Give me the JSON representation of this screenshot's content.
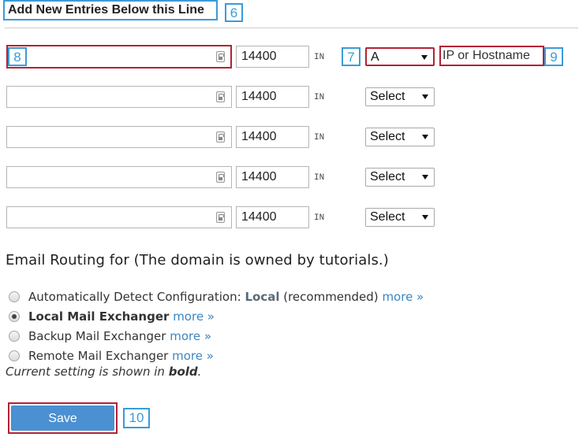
{
  "header": {
    "title": "Add New Entries Below this Line"
  },
  "callouts": {
    "header": "6",
    "name": "8",
    "type": "7",
    "target": "9",
    "save": "10"
  },
  "entries": [
    {
      "ttl": "14400",
      "class": "IN",
      "type": "A"
    },
    {
      "ttl": "14400",
      "class": "IN",
      "type": "Select"
    },
    {
      "ttl": "14400",
      "class": "IN",
      "type": "Select"
    },
    {
      "ttl": "14400",
      "class": "IN",
      "type": "Select"
    },
    {
      "ttl": "14400",
      "class": "IN",
      "type": "Select"
    }
  ],
  "target_placeholder": "IP or Hostname",
  "email_routing": {
    "title": "Email Routing for (The domain is owned by tutorials.)",
    "options": [
      {
        "label": "Automatically Detect Configuration: ",
        "detected": "Local",
        "suffix": " (recommended) ",
        "more": "more »",
        "checked": false
      },
      {
        "label": "Local Mail Exchanger",
        "more": "more »",
        "checked": true
      },
      {
        "label": "Backup Mail Exchanger",
        "more": "more »",
        "checked": false
      },
      {
        "label": "Remote Mail Exchanger",
        "more": "more »",
        "checked": false
      }
    ],
    "note_prefix": "Current setting is shown in ",
    "note_bold": "bold",
    "note_suffix": "."
  },
  "save_label": "Save"
}
